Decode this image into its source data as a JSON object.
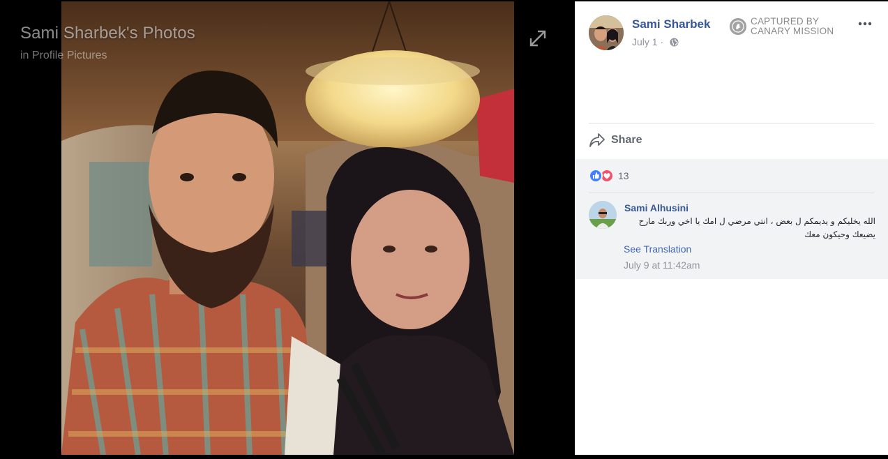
{
  "viewer": {
    "title": "Sami Sharbek's Photos",
    "subtitle": "in Profile Pictures",
    "expand_icon": "expand-arrows-icon"
  },
  "post": {
    "author": "Sami Sharbek",
    "date": "July 1 ·",
    "privacy_icon": "globe-icon",
    "badge_line1": "CAPTURED BY",
    "badge_line2": "CANARY MISSION",
    "more_icon": "more-options-icon",
    "share_label": "Share"
  },
  "reactions": {
    "types": [
      "like",
      "love"
    ],
    "count": "13"
  },
  "comment": {
    "author": "Sami Alhusini",
    "text": "الله يخليكم و يديمكم ل بعض ، انتي مرضي ل امك يا اخي وربك مارح يضيعك وحيكون معك",
    "translate_label": "See Translation",
    "time": "July 9 at 11:42am"
  },
  "colors": {
    "link_blue": "#365899",
    "like_blue": "#4080ff",
    "love_red": "#f25268",
    "feedback_bg": "#f2f3f5"
  }
}
